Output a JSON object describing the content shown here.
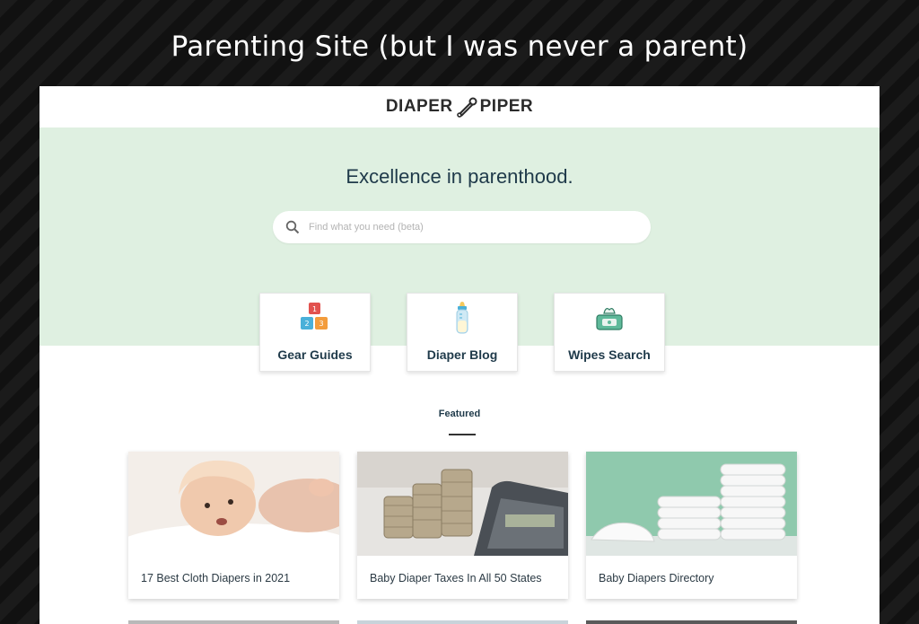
{
  "caption": "Parenting Site (but I was never a parent)",
  "header": {
    "logo_left": "DIAPER",
    "logo_right": "PIPER"
  },
  "hero": {
    "title": "Excellence in parenthood.",
    "search": {
      "placeholder": "Find what you need (beta)",
      "icon": "search-icon"
    }
  },
  "categories": [
    {
      "label": "Gear Guides",
      "icon": "toy-blocks-icon"
    },
    {
      "label": "Diaper Blog",
      "icon": "baby-bottle-icon"
    },
    {
      "label": "Wipes Search",
      "icon": "wipes-box-icon"
    }
  ],
  "featured": {
    "heading": "Featured"
  },
  "articles": [
    {
      "title": "17 Best Cloth Diapers in 2021"
    },
    {
      "title": "Baby Diaper Taxes In All 50 States"
    },
    {
      "title": "Baby Diapers Directory"
    }
  ],
  "colors": {
    "hero_bg": "#dff0e1",
    "heading": "#1f3a4a",
    "page_bg": "#141414"
  }
}
